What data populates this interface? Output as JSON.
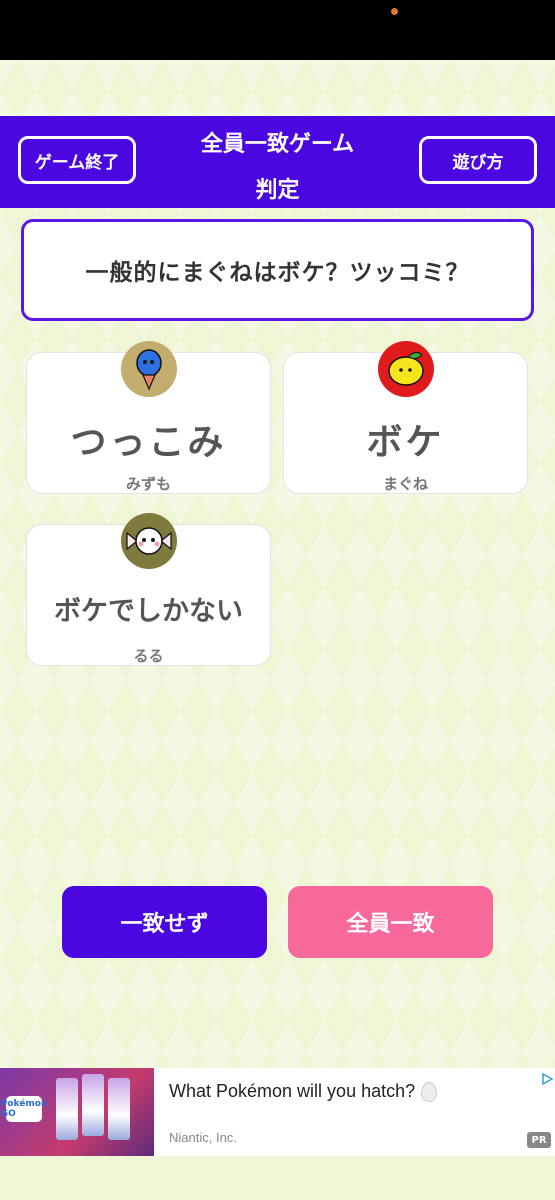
{
  "header": {
    "end_button": "ゲーム終了",
    "title_line1": "全員一致ゲーム",
    "title_line2": "判定",
    "howto_button": "遊び方"
  },
  "question": "一般的にまぐねはボケ？ツッコミ？",
  "answers": [
    {
      "answer": "つっこみ",
      "player": "みずも",
      "avatar_icon": "blue-balloon-icon"
    },
    {
      "answer": "ボケ",
      "player": "まぐね",
      "avatar_icon": "lemon-icon"
    },
    {
      "answer": "ボケでしかない",
      "player": "るる",
      "avatar_icon": "candy-icon"
    }
  ],
  "buttons": {
    "disagree": "一致せず",
    "agree": "全員一致"
  },
  "ad": {
    "headline": "What Pokémon will you hatch?",
    "advertiser": "Niantic, Inc.",
    "badge": "PR",
    "logo_text": "Pokémon GO"
  },
  "colors": {
    "primary": "#4a07e0",
    "accent_pink": "#f8699b",
    "background": "#eff6d5"
  }
}
